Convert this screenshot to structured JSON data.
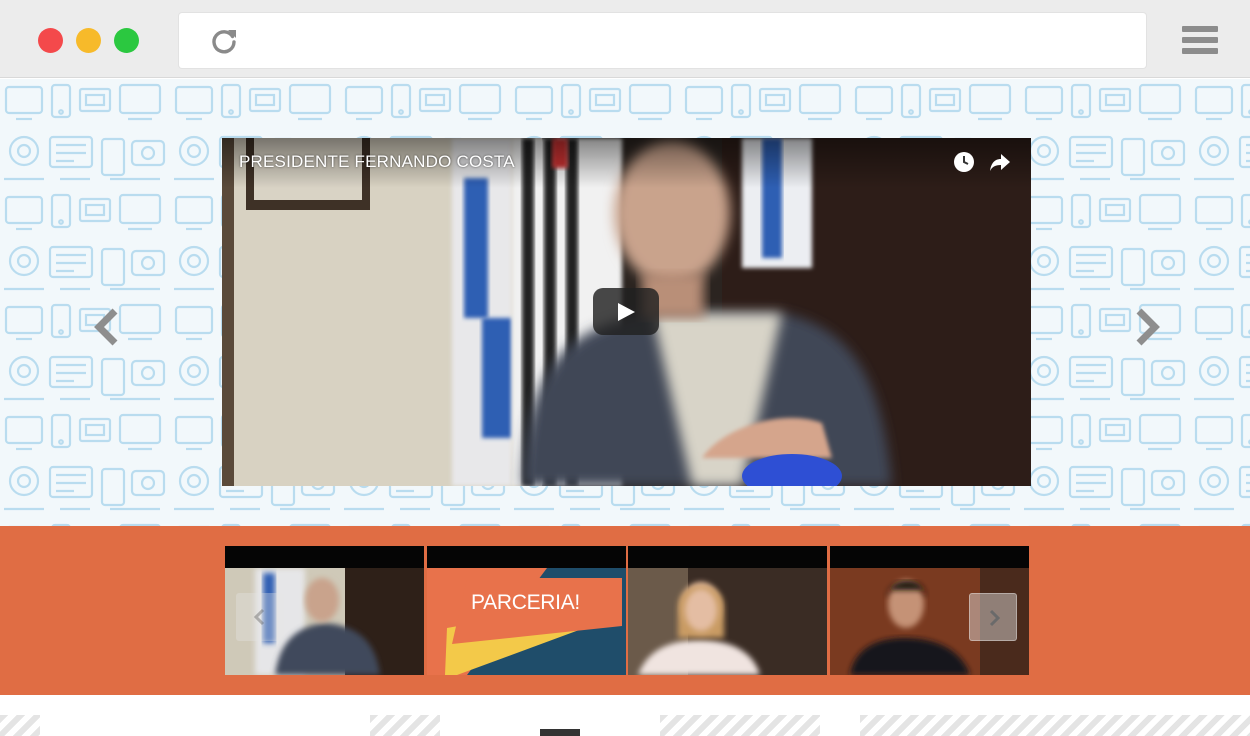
{
  "browser": {
    "traffic_lights": {
      "close_color": "#f4494b",
      "minimize_color": "#f7ba2a",
      "zoom_color": "#2bc840"
    },
    "address_bar": {
      "value": ""
    },
    "reload_icon": "reload-icon",
    "menu_icon": "hamburger-icon"
  },
  "hero": {
    "background_color": "#f2f8fb",
    "pattern_color": "#b9dcef",
    "video": {
      "title": "PRESIDENTE FERNANDO COSTA",
      "icons": [
        "clock-icon",
        "share-icon",
        "play-icon"
      ]
    },
    "prev_icon": "chevron-left-icon",
    "next_icon": "chevron-right-icon"
  },
  "carousel": {
    "background_color": "#e06d44",
    "thumbnails": [
      {
        "label": ""
      },
      {
        "label": "PARCERIA!"
      },
      {
        "label": ""
      },
      {
        "label": ""
      }
    ],
    "prev_icon": "chevron-left-icon",
    "next_icon": "chevron-right-icon"
  }
}
